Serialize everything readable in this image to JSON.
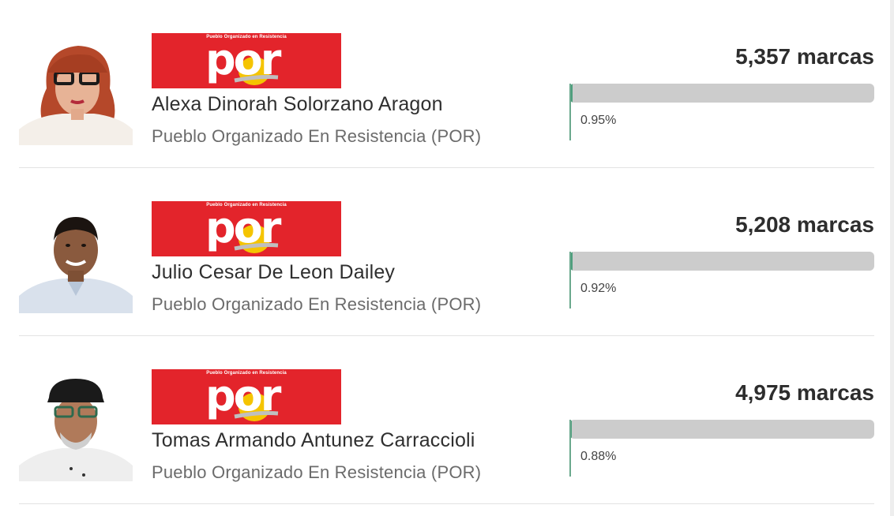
{
  "candidates": [
    {
      "name": "Alexa Dinorah Solorzano Aragon",
      "party": "Pueblo Organizado En Resistencia (POR)",
      "votes": "5,357 marcas",
      "percent": "0.95%",
      "percent_value": 0.95,
      "logo_tagline": "Pueblo Organizado en Resistencia",
      "logo_text": "por"
    },
    {
      "name": "Julio Cesar De Leon Dailey",
      "party": "Pueblo Organizado En Resistencia (POR)",
      "votes": "5,208 marcas",
      "percent": "0.92%",
      "percent_value": 0.92,
      "logo_tagline": "Pueblo Organizado en Resistencia",
      "logo_text": "por"
    },
    {
      "name": "Tomas Armando Antunez Carraccioli",
      "party": "Pueblo Organizado En Resistencia (POR)",
      "votes": "4,975 marcas",
      "percent": "0.88%",
      "percent_value": 0.88,
      "logo_tagline": "Pueblo Organizado en Resistencia",
      "logo_text": "por"
    }
  ],
  "colors": {
    "logo_red": "#e3242b",
    "bar_track": "#cccccc",
    "bar_fill": "#4d9e7c",
    "logo_sun": "#f5c400"
  },
  "icons": {
    "photo": "candidate-portrait",
    "logo": "por-party-logo"
  }
}
